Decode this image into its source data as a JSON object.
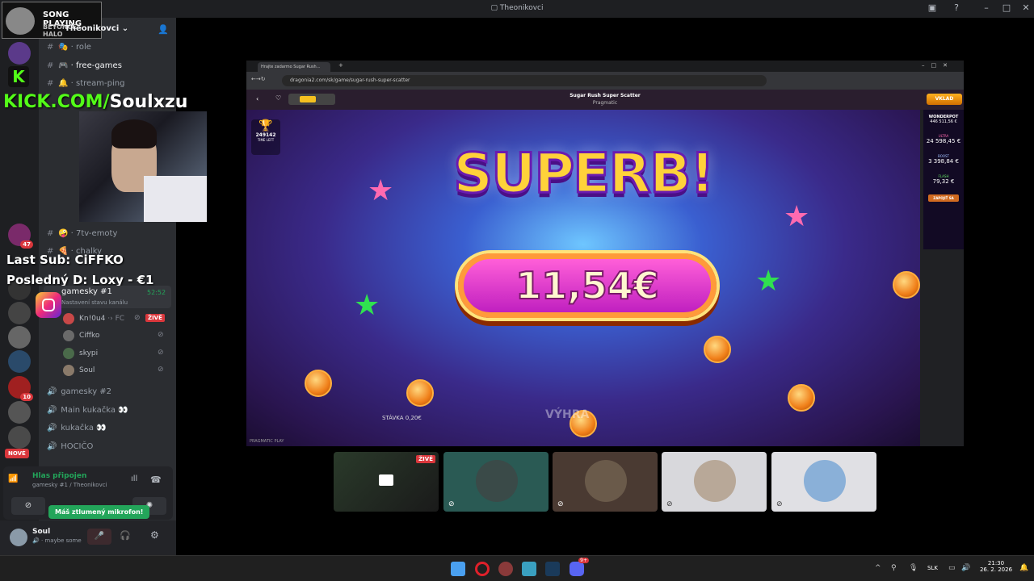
{
  "window": {
    "title": "Theonikovci"
  },
  "song": {
    "label": "SONG PLAYING",
    "artist": "BEYONCE - HALO"
  },
  "server": {
    "name": "Theonikovci"
  },
  "overlay": {
    "kick": "KICK.COM/",
    "kick_user": "Soulxzu",
    "last_sub": "Last Sub: CiFFKO",
    "last_donation": "Posledný D: Loxy - €1"
  },
  "channels": [
    {
      "name": "role"
    },
    {
      "name": "free-games"
    },
    {
      "name": "stream-ping"
    },
    {
      "name": "7tv-emoty"
    },
    {
      "name": "chalky"
    }
  ],
  "voice": {
    "channel1": "gamesky #1",
    "channel1_time": "52:52",
    "channel1_status": "Nastavení stavu kanálu",
    "users": [
      {
        "name": "Kn!0u4",
        "live": "ŽIVĚ"
      },
      {
        "name": "Ciffko"
      },
      {
        "name": "skypi"
      },
      {
        "name": "Soul"
      }
    ],
    "channel2": "gamesky #2",
    "channel3": "Main kukačka 👀",
    "channel4": "kukačka 👀",
    "channel5": "HOCIČO",
    "new_badge": "NOVÉ"
  },
  "guild_badges": {
    "b1": "47",
    "b2": "10"
  },
  "voice_panel": {
    "status": "Hlas připojen",
    "location": "gamesky #1 / Theonikovci",
    "tooltip": "Máš ztlumený mikrofon!"
  },
  "user": {
    "name": "Soul",
    "status": "maybe some"
  },
  "browser": {
    "tab": "Hrajte zadarmo Sugar Rush...",
    "url": "dragonia2.com/sk/game/sugar-rush-super-scatter",
    "game_title": "Sugar Rush Super Scatter",
    "provider": "Pragmatic",
    "deposit": "VKLAD"
  },
  "game": {
    "headline": "SUPERB!",
    "win": "11,54€",
    "trophy_value": "249142",
    "time_left": "TIME LEFT",
    "bet_label": "STÁVKA",
    "bet_value": "0,20€",
    "win_label": "VÝHRA",
    "bottom_left": "PRAGMATIC PLAY"
  },
  "wonderpot": {
    "title": "WONDERPOT",
    "total": "446 511,56 €",
    "ultra_label": "ULTRA",
    "ultra": "24 598,45 €",
    "boost_label": "BOOST",
    "boost": "3 398,84 €",
    "flash_label": "FLASH",
    "flash": "79,32 €",
    "join": "ZAPOJIŤ SA"
  },
  "thumb_live": "ŽIVĚ",
  "taskbar": {
    "lang": "SLK",
    "time": "21:30",
    "date": "26. 2. 2026",
    "notif": "9+"
  }
}
